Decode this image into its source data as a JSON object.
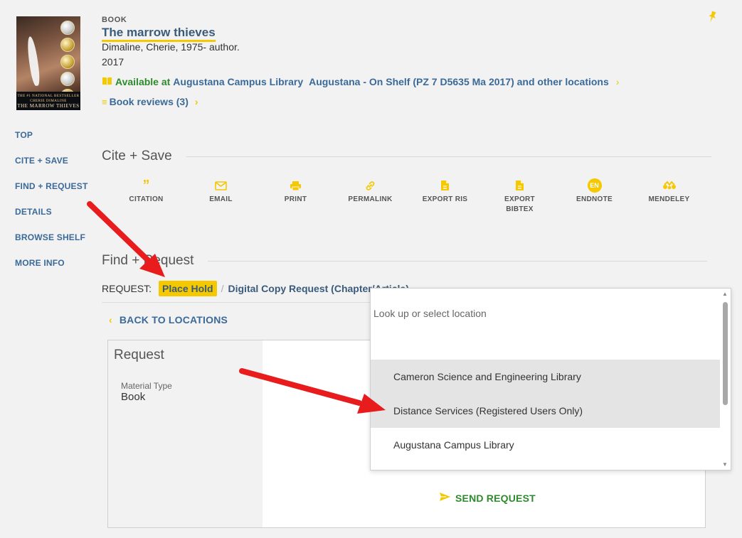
{
  "record": {
    "type": "BOOK",
    "title": "The marrow thieves",
    "author": "Dimaline, Cherie, 1975- author.",
    "year": "2017",
    "availability": {
      "status": "Available at",
      "location": "Augustana Campus Library",
      "shelf": "Augustana - On Shelf (PZ 7 D5635 Ma 2017) and other locations"
    },
    "reviews": "Book reviews (3)"
  },
  "cover": {
    "banner": "THE #1 NATIONAL BESTSELLER",
    "author": "CHERIE DIMALINE",
    "title": "THE MARROW THIEVES"
  },
  "sidenav": [
    "TOP",
    "CITE + SAVE",
    "FIND + REQUEST",
    "DETAILS",
    "BROWSE SHELF",
    "MORE INFO"
  ],
  "cite_save": {
    "heading": "Cite + Save",
    "actions": [
      {
        "label": "CITATION",
        "icon": "quote-icon"
      },
      {
        "label": "EMAIL",
        "icon": "envelope-icon"
      },
      {
        "label": "PRINT",
        "icon": "printer-icon"
      },
      {
        "label": "PERMALINK",
        "icon": "link-icon"
      },
      {
        "label": "EXPORT RIS",
        "icon": "file-icon"
      },
      {
        "label": "EXPORT BIBTEX",
        "icon": "file-icon"
      },
      {
        "label": "ENDNOTE",
        "icon": "en-badge-icon",
        "badge": "EN"
      },
      {
        "label": "MENDELEY",
        "icon": "mendeley-icon"
      }
    ]
  },
  "find_request": {
    "heading": "Find + Request",
    "request_label": "REQUEST:",
    "place_hold": "Place Hold",
    "separator": "/",
    "digital_copy": "Digital Copy Request (Chapter/Article)",
    "back": "BACK TO LOCATIONS"
  },
  "request_form": {
    "heading": "Request",
    "material_type_label": "Material Type",
    "material_type_value": "Book",
    "send": "SEND REQUEST"
  },
  "location_dropdown": {
    "placeholder": "Look up or select location",
    "options": [
      "Cameron Science and Engineering Library",
      "Distance Services (Registered Users Only)",
      "Augustana Campus Library"
    ]
  },
  "colors": {
    "accent": "#f5c800",
    "link": "#3b6a99",
    "green": "#2d8a2d",
    "annotation_arrow": "#e81c1c"
  }
}
